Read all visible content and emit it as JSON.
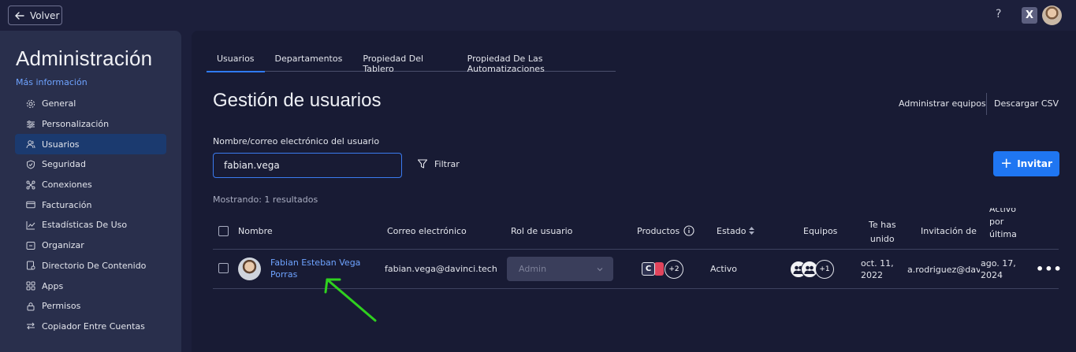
{
  "topbar": {
    "back_label": "Volver",
    "help_symbol": "?",
    "account_badge": "X"
  },
  "sidebar": {
    "title": "Administración",
    "more_info": "Más información",
    "items": [
      {
        "label": "General",
        "icon": "gear-icon"
      },
      {
        "label": "Personalización",
        "icon": "sliders-icon"
      },
      {
        "label": "Usuarios",
        "icon": "users-icon",
        "active": true
      },
      {
        "label": "Seguridad",
        "icon": "shield-icon"
      },
      {
        "label": "Conexiones",
        "icon": "connections-icon"
      },
      {
        "label": "Facturación",
        "icon": "card-icon"
      },
      {
        "label": "Estadísticas De Uso",
        "icon": "chart-icon"
      },
      {
        "label": "Organizar",
        "icon": "organize-icon"
      },
      {
        "label": "Directorio De Contenido",
        "icon": "directory-icon"
      },
      {
        "label": "Apps",
        "icon": "apps-icon"
      },
      {
        "label": "Permisos",
        "icon": "lock-icon"
      },
      {
        "label": "Copiador Entre Cuentas",
        "icon": "swap-icon"
      }
    ]
  },
  "tabs": [
    "Usuarios",
    "Departamentos",
    "Propiedad Del Tablero",
    "Propiedad De Las Automatizaciones"
  ],
  "main": {
    "title": "Gestión de usuarios",
    "manage_teams": "Administrar equipos",
    "download_csv": "Descargar CSV",
    "search_label": "Nombre/correo electrónico del usuario",
    "search_value": "fabian.vega",
    "filter_label": "Filtrar",
    "invite_label": "Invitar",
    "invite_symbol": "+",
    "results_text": "Mostrando: 1 resultados"
  },
  "table": {
    "headers": {
      "name": "Nombre",
      "email": "Correo electrónico",
      "role": "Rol de usuario",
      "products": "Productos",
      "status": "Estado",
      "teams": "Equipos",
      "joined_line1": "Te has",
      "joined_line2": "unido",
      "invited": "Invitación de",
      "active_line1": "Activo",
      "active_line2": "por",
      "active_line3": "última"
    },
    "row": {
      "name_line1": "Fabian Esteban Vega",
      "name_line2": "Porras",
      "email": "fabian.vega@davinci.tech",
      "role": "Admin",
      "product_letter": "C",
      "products_more": "+2",
      "status": "Activo",
      "teams_more": "+1",
      "joined_line1": "oct. 11,",
      "joined_line2": "2022",
      "invited_by": "a.rodriguez@davi",
      "last_active_line1": "ago. 17,",
      "last_active_line2": "2024",
      "menu_symbol": "•••"
    }
  },
  "colors": {
    "accent": "#1f76f2",
    "link": "#6ea3ff",
    "annotation_arrow": "#2fd11f"
  }
}
